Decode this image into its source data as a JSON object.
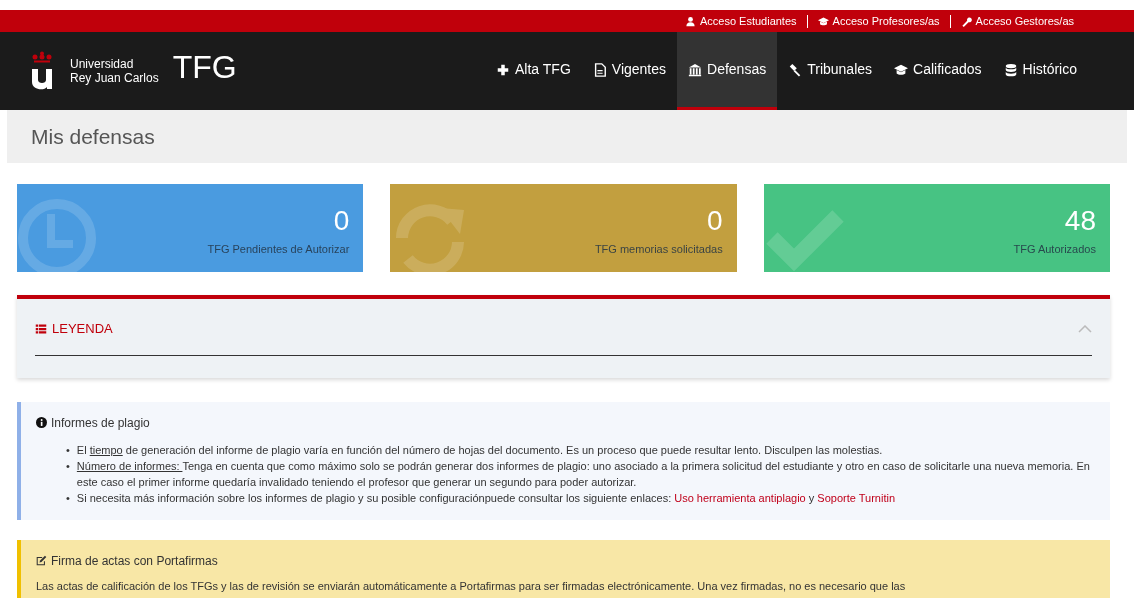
{
  "top_links": [
    {
      "label": "Acceso Estudiantes"
    },
    {
      "label": "Acceso Profesores/as"
    },
    {
      "label": "Acceso Gestores/as"
    }
  ],
  "brand": {
    "line1": "Universidad",
    "line2": "Rey Juan Carlos",
    "app": "TFG"
  },
  "nav": [
    {
      "label": "Alta TFG",
      "selected": false
    },
    {
      "label": "Vigentes",
      "selected": false
    },
    {
      "label": "Defensas",
      "selected": true
    },
    {
      "label": "Tribunales",
      "selected": false
    },
    {
      "label": "Calificados",
      "selected": false
    },
    {
      "label": "Histórico",
      "selected": false
    }
  ],
  "page_title": "Mis defensas",
  "stats": [
    {
      "value": "0",
      "label": "TFG Pendientes de Autorizar",
      "color": "#4a9be0"
    },
    {
      "value": "0",
      "label": "TFG memorias solicitadas",
      "color": "#c29f3f"
    },
    {
      "value": "48",
      "label": "TFG Autorizados",
      "color": "#47c383"
    }
  ],
  "legend": {
    "title": "LEYENDA",
    "expanded": true
  },
  "plagio": {
    "title": "Informes de plagio",
    "items": [
      {
        "marker": "•",
        "parts": [
          {
            "kind": "text",
            "text": "El "
          },
          {
            "kind": "underline",
            "text": "tiempo"
          },
          {
            "kind": "text",
            "text": " de generación del informe de plagio varía en función del número de hojas del documento. Es un proceso que puede resultar lento. Disculpen las molestias."
          }
        ]
      },
      {
        "marker": "•",
        "parts": [
          {
            "kind": "underline",
            "text": "Número de informes: "
          },
          {
            "kind": "text",
            "text": "Tenga en cuenta que como máximo solo se podrán generar dos informes de plagio: uno asociado a la primera solicitud del estudiante y otro en caso de solicitarle una nueva memoria. En este caso el primer informe quedaría invalidado teniendo el profesor que generar un segundo para poder autorizar."
          }
        ]
      },
      {
        "marker": "•",
        "parts": [
          {
            "kind": "text",
            "text": "Si necesita más información sobre los informes de plagio y su posible configuraciónpuede consultar los siguiente enlaces: "
          },
          {
            "kind": "link",
            "text": "Uso herramienta antiplagio"
          },
          {
            "kind": "text",
            "text": " y "
          },
          {
            "kind": "link",
            "text": "Soporte Turnitin"
          }
        ]
      }
    ]
  },
  "firma": {
    "title": "Firma de actas con Portafirmas",
    "text": "Las actas de calificación de los TFGs y las de revisión se enviarán automáticamente a Portafirmas para ser firmadas electrónicamente. Una vez firmadas, no es necesario que las"
  }
}
